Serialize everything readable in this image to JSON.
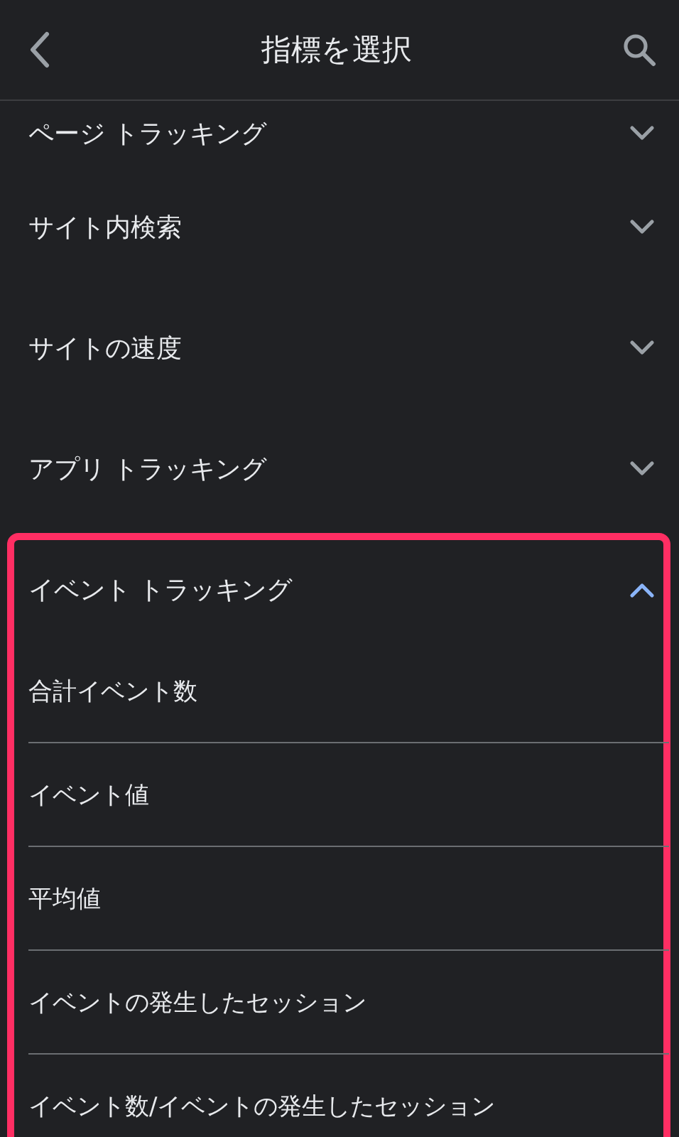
{
  "header": {
    "title": "指標を選択"
  },
  "categories": [
    {
      "label": "ページ トラッキング",
      "expanded": false,
      "highlighted": false
    },
    {
      "label": "サイト内検索",
      "expanded": false,
      "highlighted": false
    },
    {
      "label": "サイトの速度",
      "expanded": false,
      "highlighted": false
    },
    {
      "label": "アプリ トラッキング",
      "expanded": false,
      "highlighted": false
    },
    {
      "label": "イベント トラッキング",
      "expanded": true,
      "highlighted": true,
      "children": [
        {
          "label": "合計イベント数"
        },
        {
          "label": "イベント値"
        },
        {
          "label": "平均値"
        },
        {
          "label": "イベントの発生したセッション"
        },
        {
          "label": "イベント数/イベントの発生したセッション"
        }
      ]
    }
  ]
}
